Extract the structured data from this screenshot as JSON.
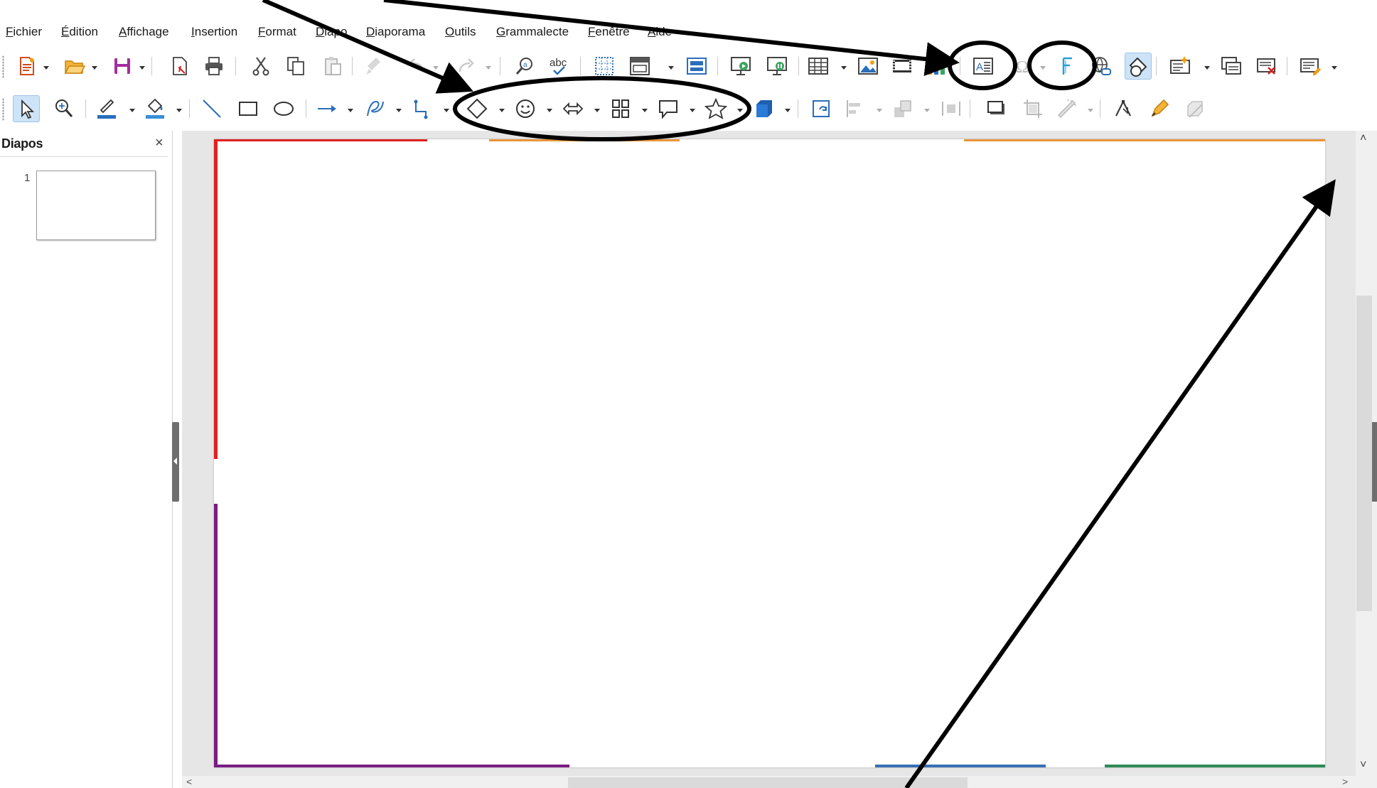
{
  "menubar": {
    "items": [
      "Fichier",
      "Édition",
      "Affichage",
      "Insertion",
      "Format",
      "Diapo",
      "Diaporama",
      "Outils",
      "Grammalecte",
      "Fenêtre",
      "Aide"
    ]
  },
  "slides_pane": {
    "title": "Diapos",
    "close_glyph": "×",
    "slide_number": "1"
  },
  "scrollbars": {
    "up_glyph": "˄",
    "down_glyph": "˅",
    "left_glyph": "<",
    "right_glyph": ">"
  },
  "toolbar_standard": {
    "icons": [
      "new-icon",
      "open-icon",
      "save-icon",
      "export-pdf-icon",
      "print-icon",
      "cut-icon",
      "copy-icon",
      "paste-icon",
      "clone-formatting-icon",
      "undo-icon",
      "redo-icon",
      "find-replace-icon",
      "spelling-icon",
      "display-grid-icon",
      "master-slide-icon",
      "slide-layout-icon",
      "start-first-slide-icon",
      "start-current-slide-icon",
      "table-icon",
      "image-icon",
      "media-icon",
      "chart-icon",
      "text-box-icon",
      "special-character-icon",
      "fontwork-icon",
      "hyperlink-icon",
      "draw-functions-icon",
      "new-slide-icon",
      "duplicate-slide-icon",
      "delete-slide-icon",
      "display-views-icon"
    ],
    "highlighted": "draw-functions-icon"
  },
  "toolbar_drawing": {
    "icons": [
      "select-icon",
      "zoom-pan-icon",
      "line-color-icon",
      "fill-color-icon",
      "line-icon",
      "rectangle-icon",
      "ellipse-icon",
      "arrow-line-icon",
      "curves-icon",
      "connectors-icon",
      "basic-shapes-icon",
      "symbol-shapes-icon",
      "block-arrows-icon",
      "flowchart-icon",
      "callouts-icon",
      "stars-icon",
      "3d-objects-icon",
      "rotate-icon",
      "align-icon",
      "arrange-icon",
      "distribute-icon",
      "shadow-icon",
      "crop-icon",
      "filter-icon",
      "points-icon",
      "glue-points-icon",
      "toggle-extrusion-icon"
    ],
    "selected": "select-icon"
  },
  "colors": {
    "accent_blue": "#2a6ebb",
    "highlight_bg": "#cde3f7",
    "slide_edge_red": "#e02020",
    "slide_edge_purple": "#7a1d82",
    "slide_edge_orange": "#e8963a",
    "slide_edge_blue": "#3a6fb5",
    "slide_edge_green": "#2e8b57",
    "annotation": "#000000"
  }
}
